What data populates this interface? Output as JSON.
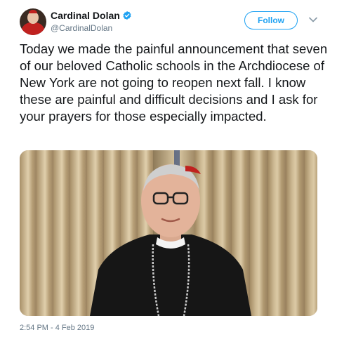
{
  "author": {
    "display_name": "Cardinal Dolan",
    "handle": "@CardinalDolan",
    "verified": true,
    "avatar_icon": "avatar-photo"
  },
  "actions": {
    "follow_label": "Follow",
    "more_icon": "chevron-down-icon"
  },
  "tweet": {
    "text": "Today we made the painful announcement that seven of our beloved Catholic schools in the Archdiocese of New York are not going to reopen next fall. I know these are painful and difficult decisions and I ask for your prayers for those especially impacted.",
    "timestamp": "2:54 PM - 4 Feb 2019"
  },
  "colors": {
    "accent": "#1da1f2",
    "text": "#14171a",
    "secondary": "#657786"
  }
}
